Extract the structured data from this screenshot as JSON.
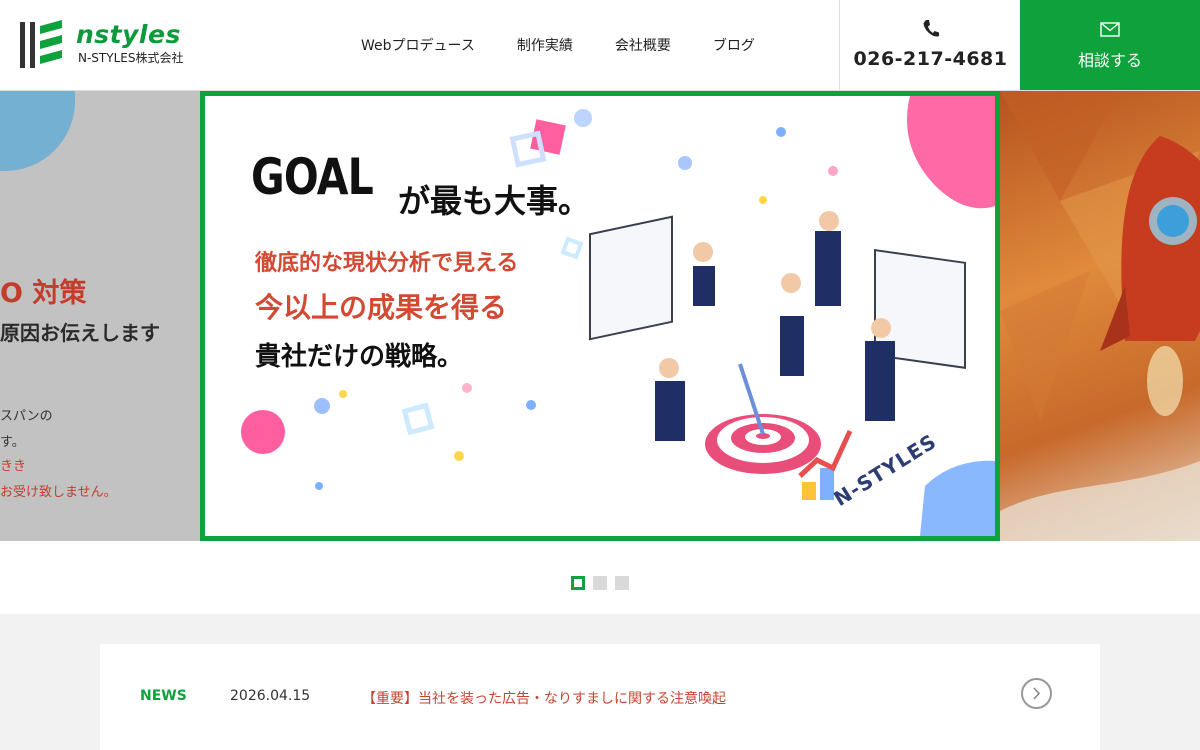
{
  "header": {
    "logo_text": "nstyles",
    "logo_sub": "N-STYLES株式会社",
    "nav": [
      "Webプロデュース",
      "制作実績",
      "会社概要",
      "ブログ"
    ],
    "phone_icon": "phone-icon",
    "phone_number": "026-217-4681",
    "consult_icon": "mail-icon",
    "consult_label": "相談する"
  },
  "slider": {
    "left_slide": {
      "title": "O 対策",
      "subtitle": "原因お伝えします",
      "lines": [
        "スパンの",
        "す。",
        "きき",
        "お受け致しません。"
      ]
    },
    "main_slide": {
      "headline_latin": "GOAL",
      "headline_rest": "が最も大事。",
      "line1": "徹底的な現状分析で見える",
      "line2": "今以上の成果を得る",
      "line3": "貴社だけの戦略。",
      "stamp": "N-STYLES"
    },
    "pagination": {
      "count": 3,
      "active": 0
    }
  },
  "news": {
    "label": "NEWS",
    "date": "2026.04.15",
    "title": "【重要】当社を装った広告・なりすましに関する注意喚起",
    "arrow_icon": "chevron-right-icon"
  },
  "colors": {
    "brand_green": "#0fa13b",
    "accent_red": "#c6442f"
  }
}
